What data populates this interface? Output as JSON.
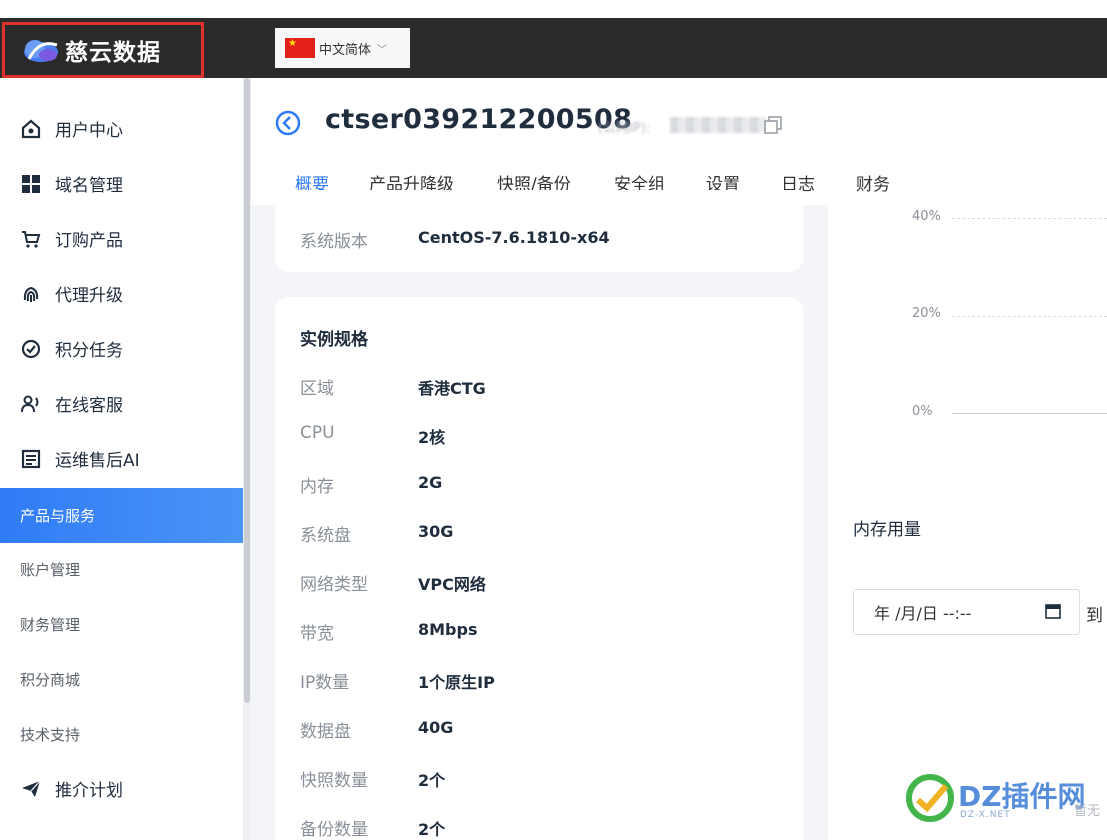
{
  "brand": {
    "name": "慈云数据"
  },
  "language": {
    "label": "中文简体"
  },
  "sidebar": {
    "items": [
      {
        "label": "用户中心",
        "icon": "home-icon"
      },
      {
        "label": "域名管理",
        "icon": "grid-icon"
      },
      {
        "label": "订购产品",
        "icon": "cart-icon"
      },
      {
        "label": "代理升级",
        "icon": "fingerprint-icon"
      },
      {
        "label": "积分任务",
        "icon": "badge-check-icon"
      },
      {
        "label": "在线客服",
        "icon": "support-icon"
      },
      {
        "label": "运维售后AI",
        "icon": "document-icon"
      }
    ],
    "sub_items": [
      "产品与服务",
      "账户管理",
      "财务管理",
      "积分商城",
      "技术支持"
    ],
    "bottom_item": {
      "label": "推介计划",
      "icon": "send-icon"
    },
    "active": "产品与服务"
  },
  "header": {
    "server_name": "ctser039212200508",
    "ip_label": "(公网IP):"
  },
  "tabs": [
    "概要",
    "产品升降级",
    "快照/备份",
    "安全组",
    "设置",
    "日志",
    "财务"
  ],
  "system_card": {
    "label": "系统版本",
    "value": "CentOS-7.6.1810-x64"
  },
  "spec_card": {
    "title": "实例规格",
    "rows": [
      {
        "label": "区域",
        "value": "香港CTG"
      },
      {
        "label": "CPU",
        "value": "2核"
      },
      {
        "label": "内存",
        "value": "2G"
      },
      {
        "label": "系统盘",
        "value": "30G"
      },
      {
        "label": "网络类型",
        "value": "VPC网络"
      },
      {
        "label": "带宽",
        "value": "8Mbps"
      },
      {
        "label": "IP数量",
        "value": "1个原生IP"
      },
      {
        "label": "数据盘",
        "value": "40G"
      },
      {
        "label": "快照数量",
        "value": "2个"
      },
      {
        "label": "备份数量",
        "value": "2个"
      }
    ]
  },
  "cpu_chart": {
    "ticks": [
      "40%",
      "20%",
      "0%"
    ]
  },
  "memory": {
    "title": "内存用量",
    "date_placeholder": "年 /月/日 --:--",
    "to_label": "到"
  },
  "watermark": {
    "text": "DZ插件网",
    "sub": "DZ-X.NET",
    "faint": "暂无"
  },
  "colors": {
    "accent": "#2f7cf6",
    "topbar": "#2b2b2b",
    "highlight_border": "#e0322c"
  }
}
